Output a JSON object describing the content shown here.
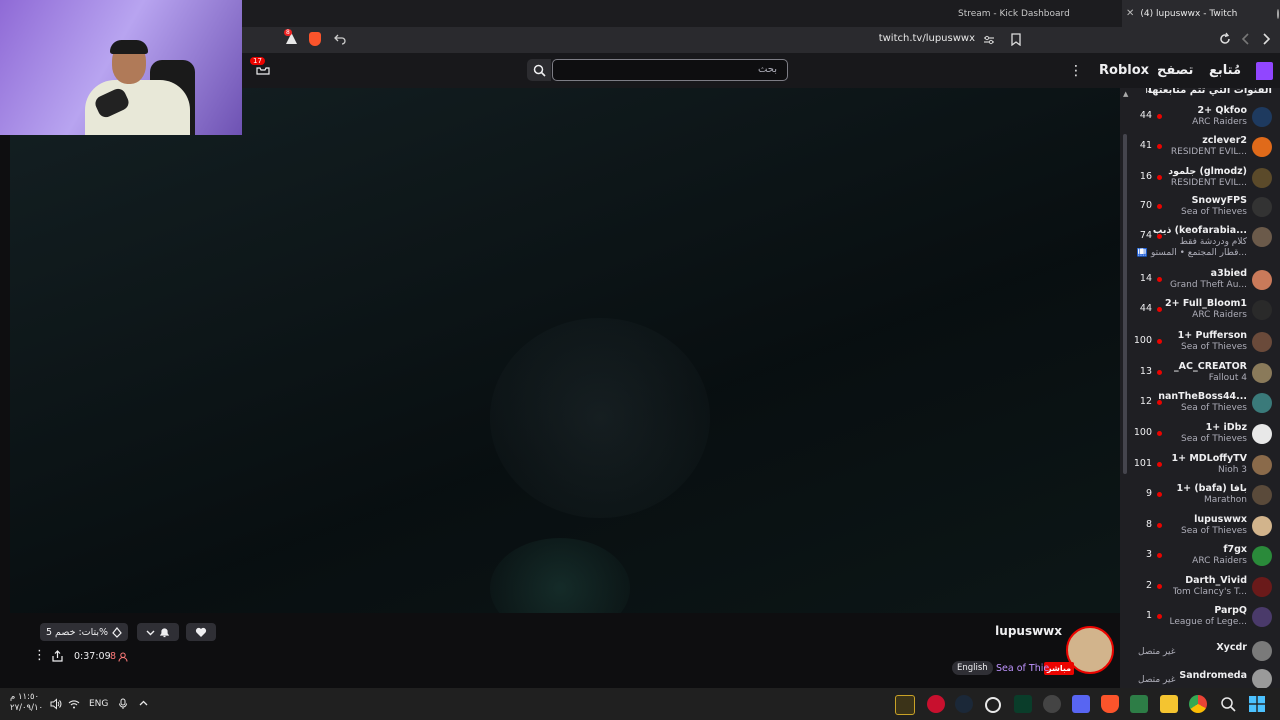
{
  "browser": {
    "tabs": [
      {
        "label": "Stream - Kick Dashboard",
        "active": false
      },
      {
        "label": "(4) lupuswwx - Twitch",
        "active": true
      }
    ],
    "url": "twitch.tv/lupuswwx",
    "extension_badge": "8"
  },
  "nav": {
    "following": "مُتابع",
    "browse": "تصفح",
    "roblox": "Roblox",
    "search_placeholder": "بحث",
    "notifications_count": "17"
  },
  "sidebar": {
    "header": "القنوات التي تتم متابعتها",
    "channels": [
      {
        "name": "2+ Qkfoo",
        "game": "ARC Raiders",
        "viewers": "44",
        "avatar_color": "#1e3a5f"
      },
      {
        "name": "zclever2",
        "game": "RESIDENT EVIL...",
        "viewers": "41",
        "avatar_color": "#e06a1a"
      },
      {
        "name": "جلمود (glmodz)",
        "game": "RESIDENT EVIL...",
        "viewers": "16",
        "avatar_color": "#5b4a2a"
      },
      {
        "name": "SnowyFPS",
        "game": "Sea of Thieves",
        "viewers": "70",
        "avatar_color": "#333333"
      },
      {
        "name": "ذيب (keofarabia...",
        "game": "كلام ودردشة فقط",
        "extra": "🛄 قطار المجتمع • المستو...",
        "viewers": "74",
        "avatar_color": "#6b5a4a"
      },
      {
        "name": "a3bied",
        "game": "Grand Theft Au...",
        "viewers": "14",
        "avatar_color": "#c97a5a"
      },
      {
        "name": "2+ Full_Bloom1",
        "game": "ARC Raiders",
        "viewers": "44",
        "avatar_color": "#2a2a2a"
      },
      {
        "name": "1+ Pufferson",
        "game": "Sea of Thieves",
        "viewers": "100",
        "avatar_color": "#6a4a3a"
      },
      {
        "name": "_AC_CREATOR",
        "game": "Fallout 4",
        "viewers": "13",
        "avatar_color": "#8a7a5a"
      },
      {
        "name": "nanTheBoss44...",
        "game": "Sea of Thieves",
        "viewers": "12",
        "avatar_color": "#3a7a7a"
      },
      {
        "name": "1+ iDbz",
        "game": "Sea of Thieves",
        "viewers": "100",
        "avatar_color": "#e8e8e8"
      },
      {
        "name": "1+ MDLoffyTV",
        "game": "Nioh 3",
        "viewers": "101",
        "avatar_color": "#8a6a4a"
      },
      {
        "name": "1+ (bafa) بافا",
        "game": "Marathon",
        "viewers": "9",
        "avatar_color": "#5a4a3a"
      },
      {
        "name": "lupuswwx",
        "game": "Sea of Thieves",
        "viewers": "8",
        "avatar_color": "#d2b48c"
      },
      {
        "name": "f7gx",
        "game": "ARC Raiders",
        "viewers": "3",
        "avatar_color": "#2a8a3a"
      },
      {
        "name": "Darth_Vivid",
        "game": "Tom Clancy's T...",
        "viewers": "2",
        "avatar_color": "#6a1a1a"
      },
      {
        "name": "ParpQ",
        "game": "League of Lege...",
        "viewers": "1",
        "avatar_color": "#4a3a6a"
      }
    ],
    "offline": [
      {
        "name": "Xycdr",
        "status": "غير متصل",
        "avatar_color": "#7a7a7a"
      },
      {
        "name": "Sandromeda",
        "status": "غير متصل",
        "avatar_color": "#9a9a9a"
      }
    ]
  },
  "stream": {
    "streamer": "lupuswwx",
    "game": "Sea of Thie",
    "live_label": "مباشر",
    "language": "English",
    "uptime": "0:37:09",
    "viewers": "8",
    "subs_label": "بتات: خصم 5%"
  },
  "taskbar": {
    "language": "ENG",
    "time": "١١:٥٠ م",
    "date": "٢٧/٠٩/١٠"
  }
}
